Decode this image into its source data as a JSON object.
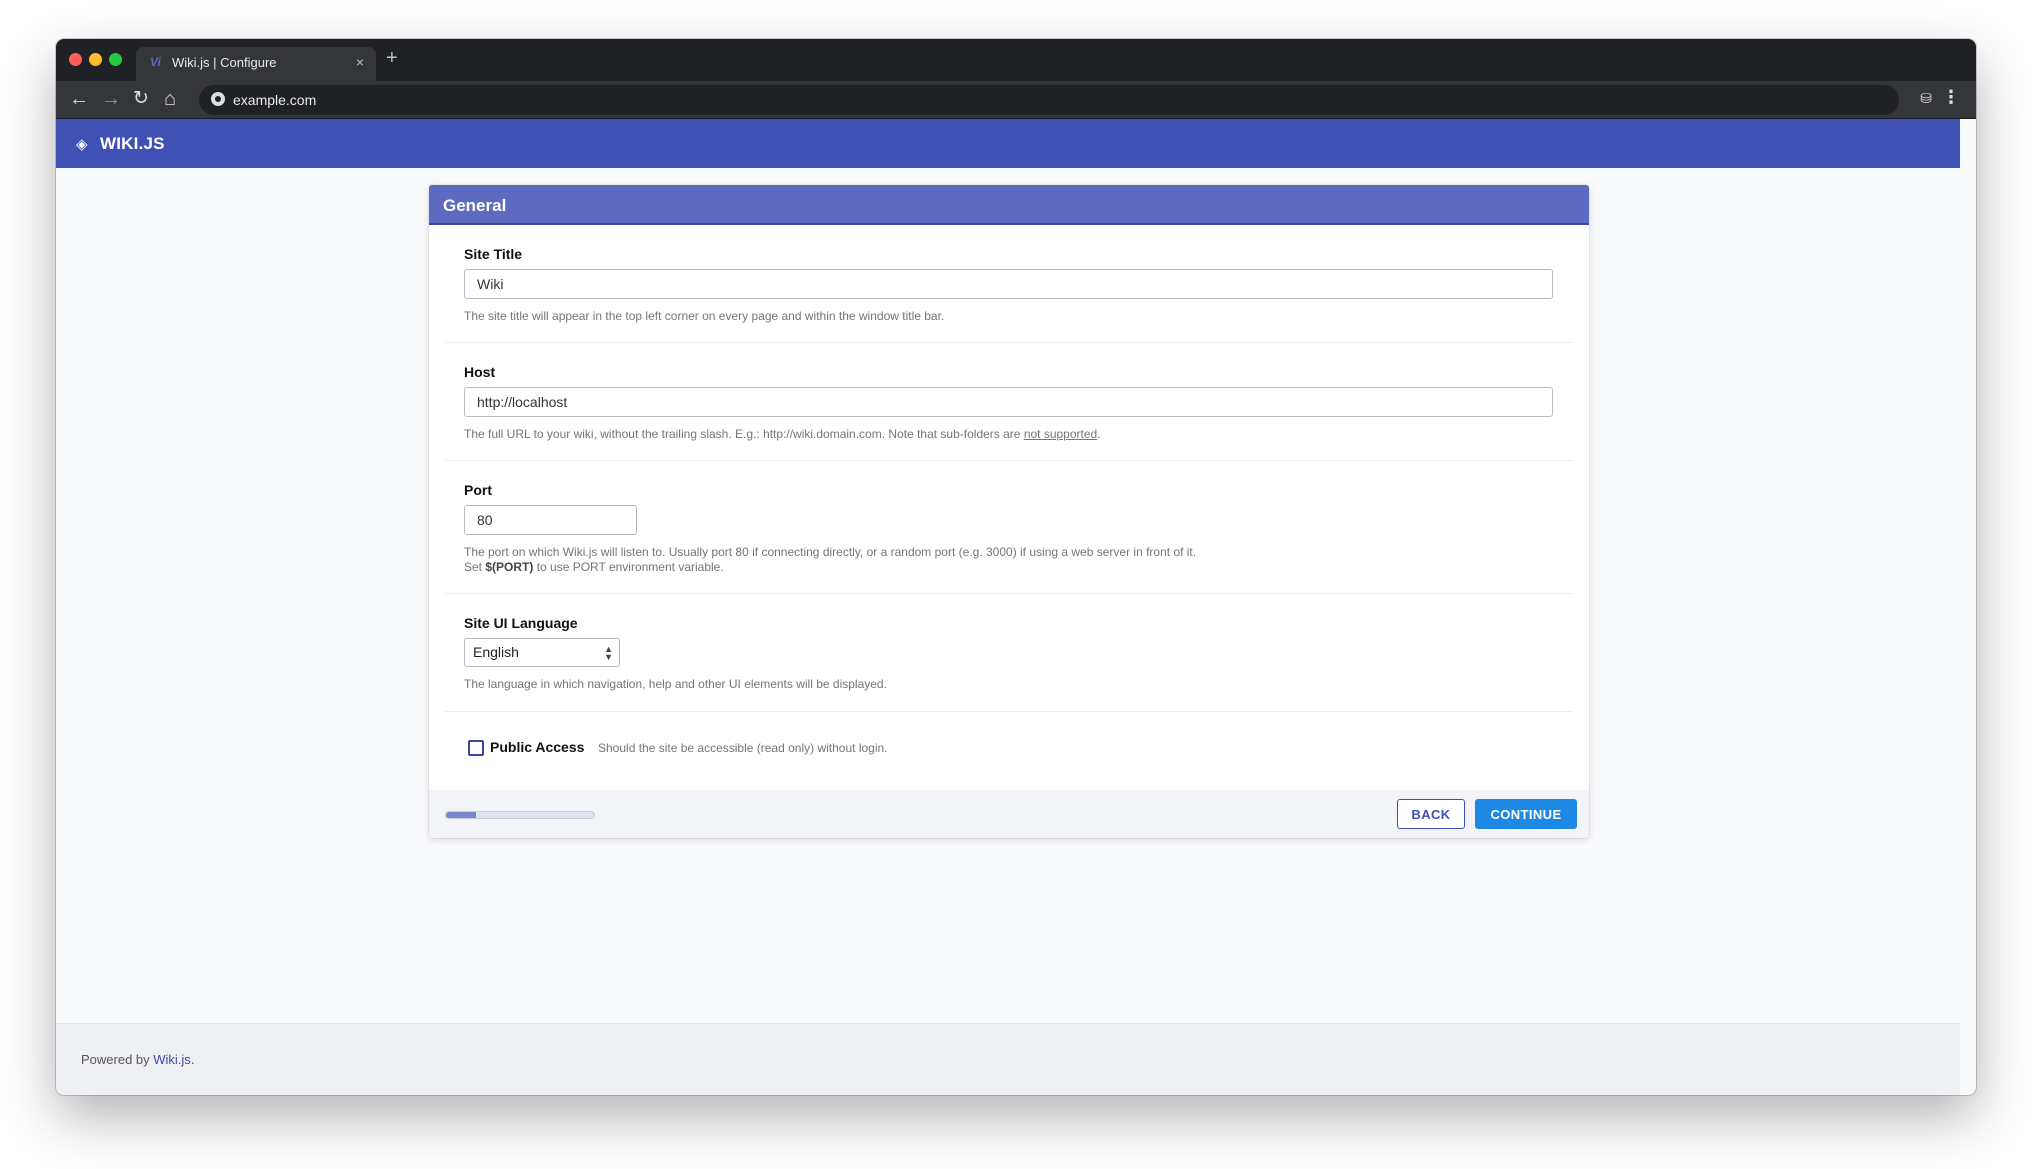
{
  "browser": {
    "tab_title": "Wiki.js | Configure",
    "tab_favicon": "Vi",
    "tab_close": "×",
    "new_tab": "+",
    "url": "example.com",
    "icons": [
      "back-arrow-icon",
      "forward-arrow-icon",
      "reload-icon",
      "home-icon",
      "site-info-icon",
      "incognito-icon",
      "kebab-menu-icon"
    ]
  },
  "app": {
    "logo_text": "WIKI.JS",
    "brand_color": "#3f51b5"
  },
  "panel": {
    "title": "General",
    "site_title": {
      "label": "Site Title",
      "value": "Wiki",
      "help": "The site title will appear in the top left corner on every page and within the window title bar."
    },
    "host": {
      "label": "Host",
      "value": "http://localhost",
      "help_before": "The full URL to your wiki, without the trailing slash. E.g.: http://wiki.domain.com. Note that sub-folders are ",
      "help_link": "not supported",
      "help_after": "."
    },
    "port": {
      "label": "Port",
      "value": "80",
      "help_line1": "The port on which Wiki.js will listen to. Usually port 80 if connecting directly, or a random port (e.g. 3000) if using a web server in front of it.",
      "help_line2_before": "Set ",
      "help_line2_code": "$(PORT)",
      "help_line2_after": " to use PORT environment variable."
    },
    "language": {
      "label": "Site UI Language",
      "selected": "English",
      "help": "The language in which navigation, help and other UI elements will be displayed."
    },
    "public_access": {
      "label": "Public Access",
      "checked": false,
      "help": "Should the site be accessible (read only) without login."
    },
    "progress_fraction": 0.2,
    "back_label": "BACK",
    "continue_label": "CONTINUE"
  },
  "footer": {
    "prefix": "Powered by ",
    "link": "Wiki.js",
    "suffix": "."
  }
}
